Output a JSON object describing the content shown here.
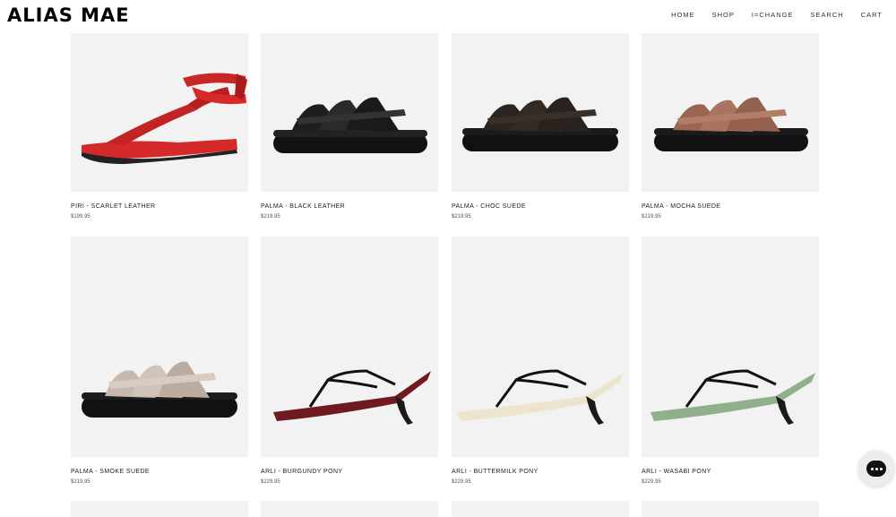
{
  "brand": {
    "logo_text": "ALIAS MAE"
  },
  "nav": {
    "items": [
      {
        "label": "HOME"
      },
      {
        "label": "SHOP"
      },
      {
        "label": "I=CHANGE"
      },
      {
        "label": "SEARCH"
      },
      {
        "label": "CART"
      }
    ]
  },
  "products": [
    {
      "name": "PIRI - SCARLET LEATHER",
      "price": "$199.95",
      "color": "#d42a2a"
    },
    {
      "name": "PALMA - BLACK LEATHER",
      "price": "$219.95",
      "color": "#1a1a1a"
    },
    {
      "name": "PALMA - CHOC SUEDE",
      "price": "$219.95",
      "color": "#2b2420"
    },
    {
      "name": "PALMA - MOCHA SUEDE",
      "price": "$219.95",
      "color": "#a06c5a"
    },
    {
      "name": "PALMA - SMOKE SUEDE",
      "price": "$219.95",
      "color": "#c8b8ac"
    },
    {
      "name": "ARLI - BURGUNDY PONY",
      "price": "$229.95",
      "color": "#6e1a1e"
    },
    {
      "name": "ARLI - BUTTERMILK PONY",
      "price": "$229.95",
      "color": "#ece4cc"
    },
    {
      "name": "ARLI - WASABI PONY",
      "price": "$229.95",
      "color": "#8fb08a"
    }
  ],
  "chat": {
    "icon": "chat-bubble-icon"
  }
}
